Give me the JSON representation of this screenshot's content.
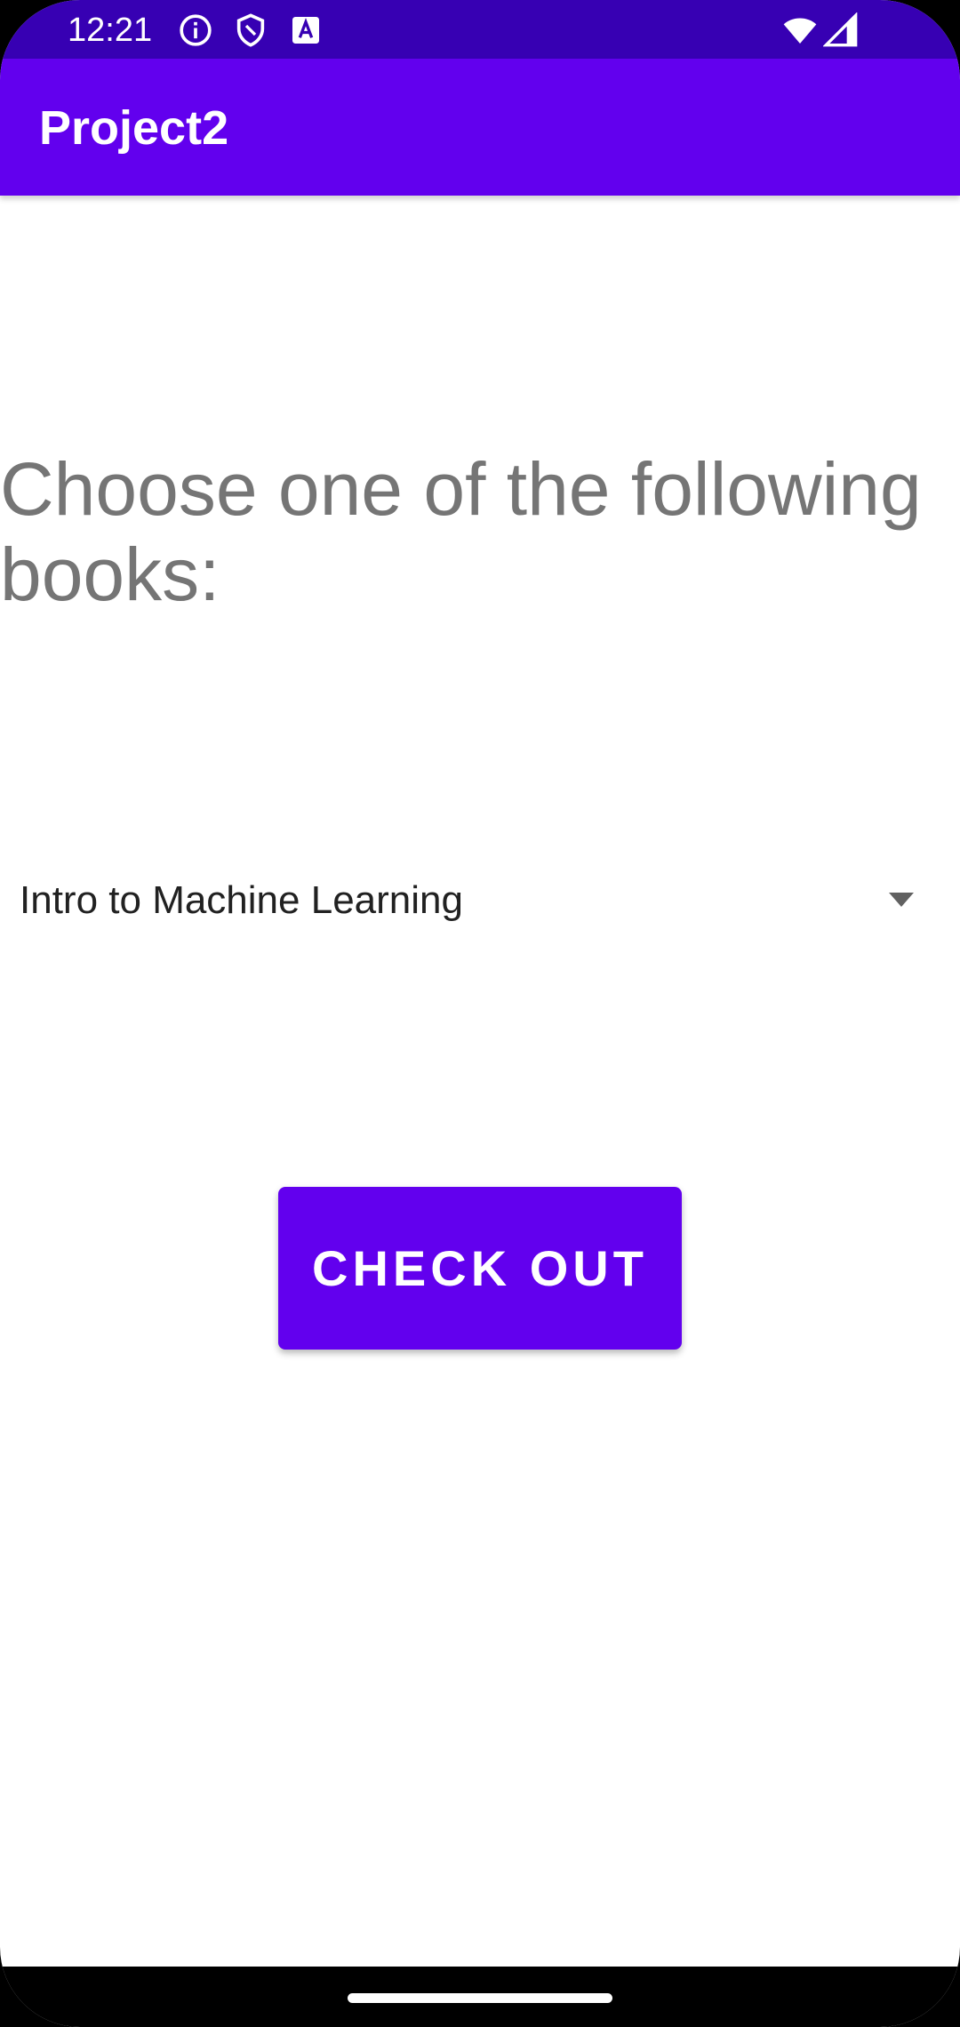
{
  "status_bar": {
    "time": "12:21",
    "icons": [
      "info-icon",
      "shield-icon",
      "keyboard-a-icon",
      "wifi-icon",
      "cellular-signal-icon"
    ],
    "background_color": "#3700b3"
  },
  "app_bar": {
    "title": "Project2",
    "background_color": "#6200ee"
  },
  "main": {
    "prompt": "Choose one of the following books:",
    "book_spinner": {
      "selected": "Intro to Machine Learning",
      "icon": "dropdown-arrow-icon"
    },
    "checkout_label": "CHECK OUT",
    "accent_color": "#6200ee"
  },
  "navigation": {
    "home_handle": "gesture-home-handle"
  }
}
